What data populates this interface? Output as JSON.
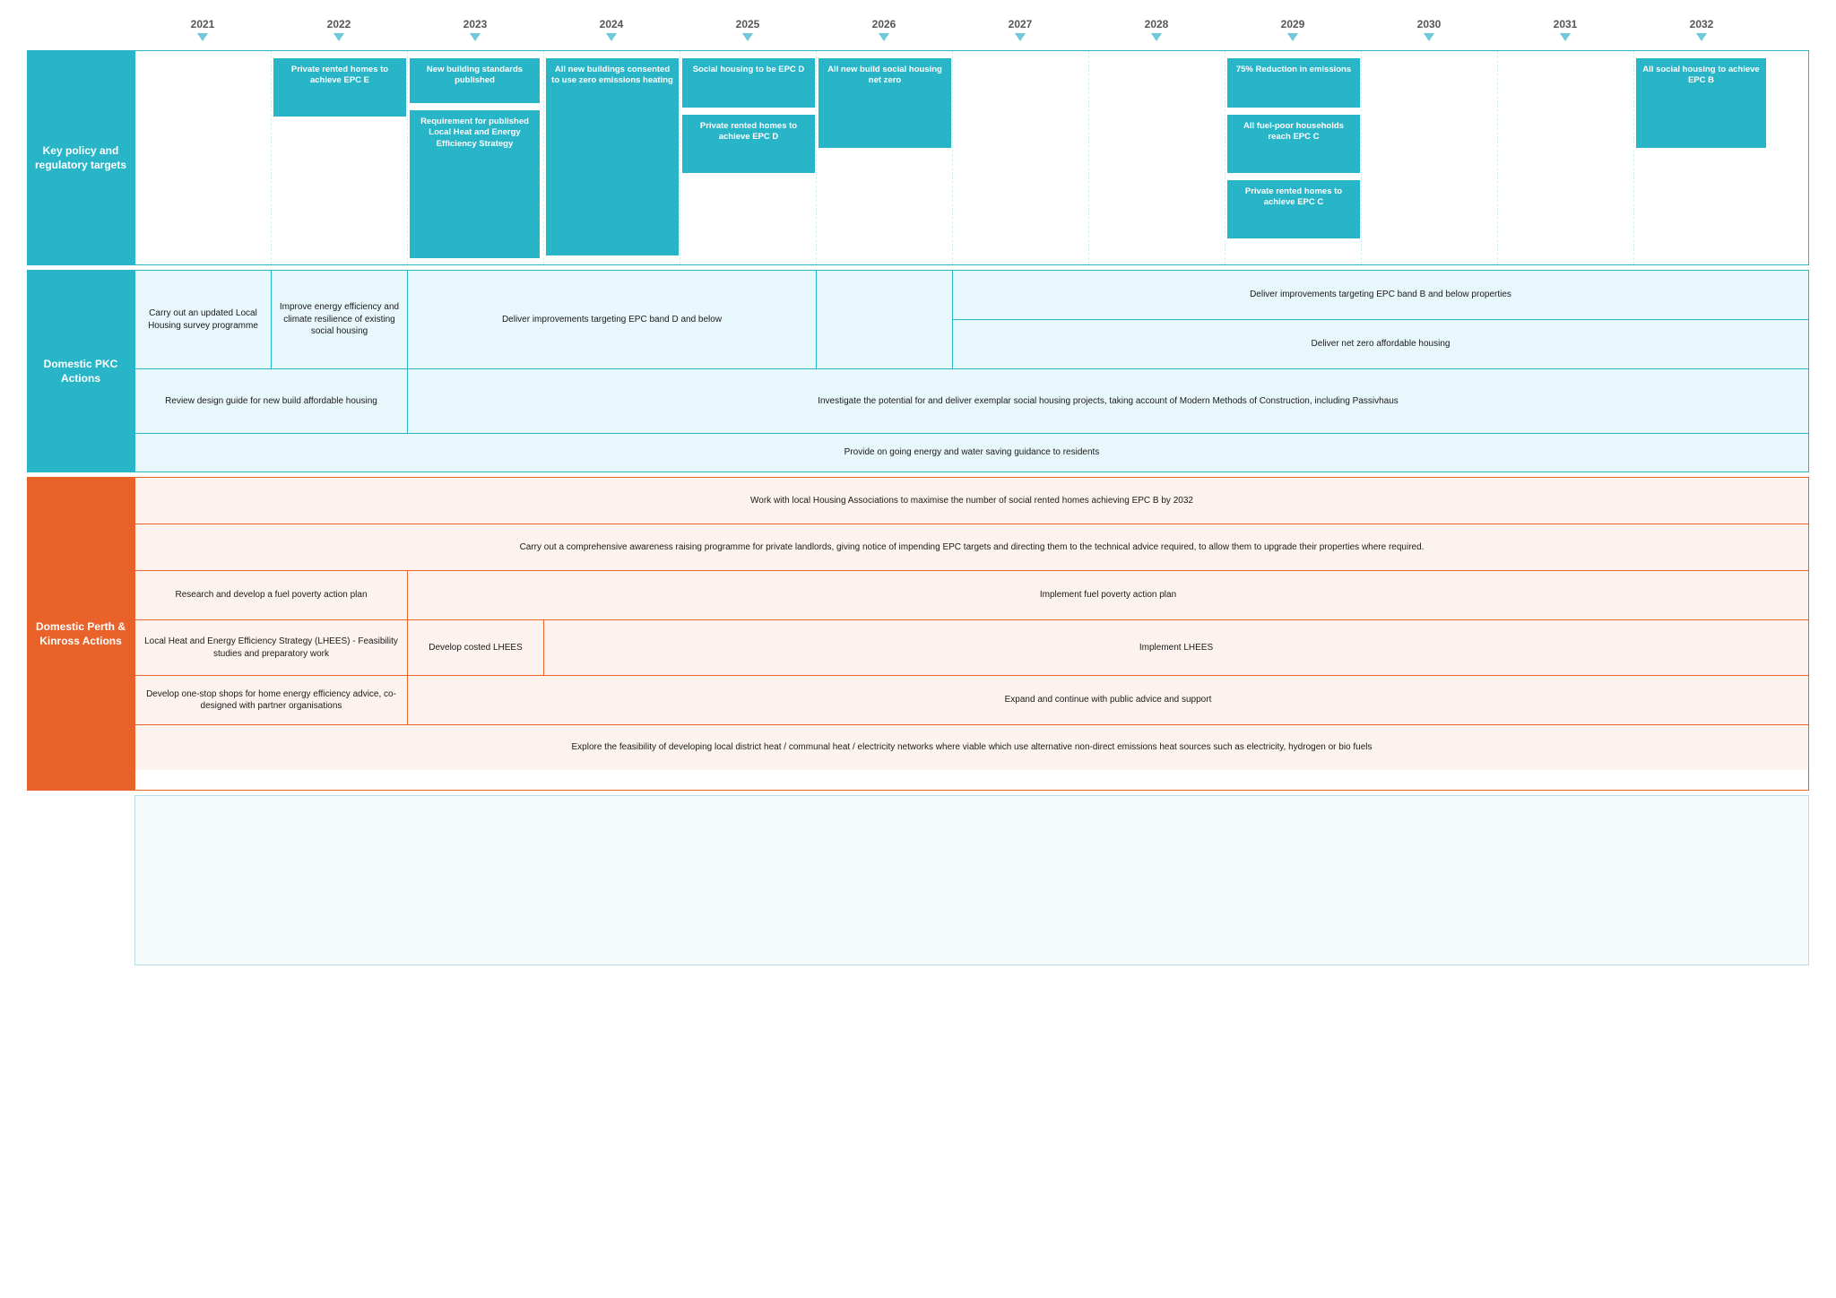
{
  "years": [
    "2021",
    "2022",
    "2023",
    "2024",
    "2025",
    "2026",
    "2027",
    "2028",
    "2029",
    "2030",
    "2031",
    "2032"
  ],
  "policy": {
    "label": "Key policy and regulatory targets",
    "targets": [
      {
        "year_position": "2022",
        "text": "Private rented homes to achieve EPC E"
      },
      {
        "year_position": "2023a",
        "text": "New building standards published"
      },
      {
        "year_position": "2023b",
        "text": "Requirement for published Local Heat and Energy Efficiency Strategy"
      },
      {
        "year_position": "2024",
        "text": "All new buildings consented to use zero emissions heating"
      },
      {
        "year_position": "2025a",
        "text": "Social housing to be EPC D"
      },
      {
        "year_position": "2025b",
        "text": "Private rented homes to achieve EPC D"
      },
      {
        "year_position": "2026",
        "text": "All new build social housing net zero"
      },
      {
        "year_position": "2029a",
        "text": "75% Reduction in emissions"
      },
      {
        "year_position": "2029b",
        "text": "All fuel-poor households reach EPC C"
      },
      {
        "year_position": "2029c",
        "text": "Private rented homes to achieve EPC C"
      },
      {
        "year_position": "2032",
        "text": "All social housing to achieve EPC B"
      }
    ]
  },
  "pkc": {
    "label": "Domestic PKC Actions",
    "rows": [
      {
        "type": "multi-left",
        "left_cells": [
          {
            "text": "Carry out an updated Local Housing survey programme",
            "width_pct": 16
          },
          {
            "text": "Improve energy efficiency and climate resilience of existing social housing",
            "width_pct": 16
          }
        ],
        "right_text": "Deliver improvements targeting EPC band D and below",
        "right_width_pct": 30,
        "far_right_text": "Deliver improvements targeting EPC band B and below properties",
        "far_right_width_pct": 38
      },
      {
        "type": "two-col-right",
        "left_text": "Carry out an updated Local Housing survey programme",
        "mid_text": "Deliver improvements targeting EPC band D and below",
        "right_text": "Deliver net zero affordable housing"
      },
      {
        "type": "full-two",
        "left_text": "Review design guide for new build affordable housing",
        "right_text": "Investigate the potential for and deliver exemplar social housing projects, taking account of Modern Methods of Construction, including Passivhaus"
      },
      {
        "type": "full-single",
        "text": "Provide on going energy and water saving guidance to residents"
      }
    ]
  },
  "pk": {
    "label": "Domestic Perth & Kinross Actions",
    "rows": [
      {
        "type": "full-single",
        "text": "Work with local Housing Associations to maximise the number of social rented homes achieving EPC B by 2032"
      },
      {
        "type": "full-single",
        "text": "Carry out a comprehensive awareness raising programme for private landlords, giving notice of impending EPC targets and directing them to the technical advice required, to allow them to upgrade their properties where required."
      },
      {
        "type": "two-col",
        "left_text": "Research and develop a fuel poverty action plan",
        "right_text": "Implement fuel poverty action plan"
      },
      {
        "type": "three-col",
        "left_text": "Local Heat and Energy Efficiency Strategy (LHEES) - Feasibility studies and preparatory work",
        "mid_text": "Develop costed LHEES",
        "right_text": "Implement LHEES"
      },
      {
        "type": "two-col",
        "left_text": "Develop one-stop shops for home energy efficiency advice, co-designed with partner organisations",
        "right_text": "Expand and continue with public advice and support"
      },
      {
        "type": "full-single",
        "text": "Explore the feasibility of developing local district heat / communal heat / electricity networks where viable which use alternative non-direct emissions heat sources such as electricity, hydrogen or bio fuels"
      }
    ]
  }
}
